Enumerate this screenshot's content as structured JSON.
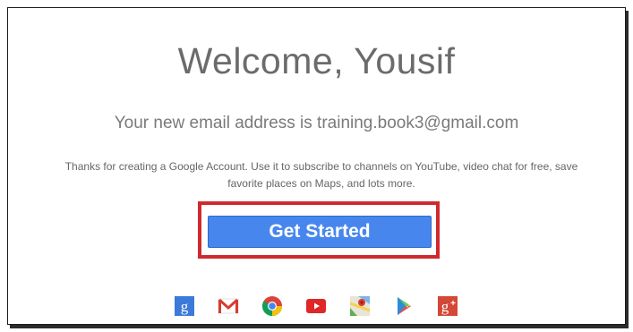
{
  "welcome": {
    "title": "Welcome, Yousif",
    "email_line": "Your new email address is training.book3@gmail.com",
    "description_line1": "Thanks for creating a Google Account. Use it to subscribe to channels on YouTube, video chat for free, save",
    "description_line2": "favorite places on Maps, and lots more."
  },
  "actions": {
    "get_started_label": "Get Started"
  },
  "colors": {
    "button": "#4787ed",
    "highlight": "#cf2a2e"
  },
  "product_icons": [
    "google-search-icon",
    "gmail-icon",
    "chrome-icon",
    "youtube-icon",
    "maps-icon",
    "play-store-icon",
    "google-plus-icon"
  ]
}
